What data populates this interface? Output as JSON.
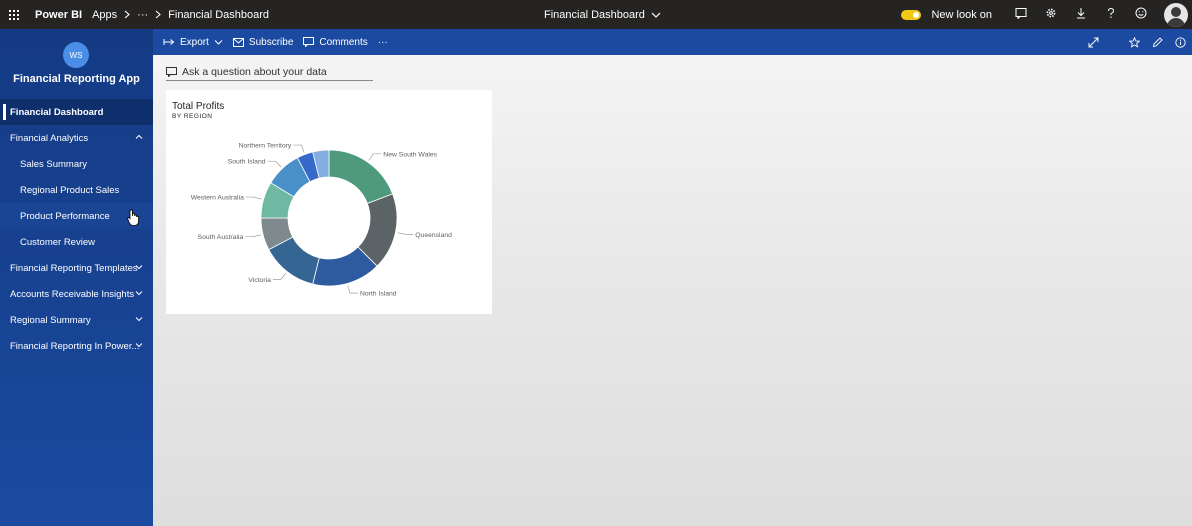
{
  "topbar": {
    "brand": "Power BI",
    "breadcrumb": [
      "Apps",
      "···",
      "Financial Dashboard"
    ],
    "center_title": "Financial Dashboard",
    "new_look_label": "New look on"
  },
  "sidebar": {
    "workspace_initials": "WS",
    "app_title": "Financial Reporting App",
    "items": [
      {
        "label": "Financial Dashboard",
        "level": 0,
        "active": true
      },
      {
        "label": "Financial Analytics",
        "level": 0,
        "expanded": true
      },
      {
        "label": "Sales Summary",
        "level": 1
      },
      {
        "label": "Regional Product Sales",
        "level": 1
      },
      {
        "label": "Product Performance",
        "level": 1
      },
      {
        "label": "Customer Review",
        "level": 1
      },
      {
        "label": "Financial Reporting Templates",
        "level": 0
      },
      {
        "label": "Accounts Receivable Insights",
        "level": 0
      },
      {
        "label": "Regional Summary",
        "level": 0
      },
      {
        "label": "Financial Reporting In Power...",
        "level": 0
      }
    ]
  },
  "actionbar": {
    "export_label": "Export",
    "subscribe_label": "Subscribe",
    "comments_label": "Comments",
    "more_label": "···"
  },
  "qa": {
    "placeholder": "Ask a question about your data"
  },
  "tile": {
    "title": "Total Profits",
    "subtitle": "BY REGION"
  },
  "chart_data": {
    "type": "pie",
    "title": "Total Profits",
    "subtitle": "BY REGION",
    "donut": true,
    "categories": [
      "New South Wales",
      "Queensland",
      "North Island",
      "Victoria",
      "South Australia",
      "Western Australia",
      "South Island",
      "Northern Territory"
    ],
    "values": [
      20,
      19,
      17,
      14,
      8,
      9,
      9,
      4
    ],
    "colors": [
      "#4f9a7d",
      "#5c6366",
      "#2e5aa0",
      "#356592",
      "#7f8a8e",
      "#6fb8a2",
      "#4a90c8",
      "#3669c9"
    ],
    "extra_slice_color": "#84aee0",
    "extra_value": 4,
    "legend": "none (data labels around slices)"
  },
  "colors": {
    "topbar": "#252423",
    "sidebar": "#143a83",
    "actionbar": "#1c4aa0",
    "toggle": "#f2c811"
  }
}
